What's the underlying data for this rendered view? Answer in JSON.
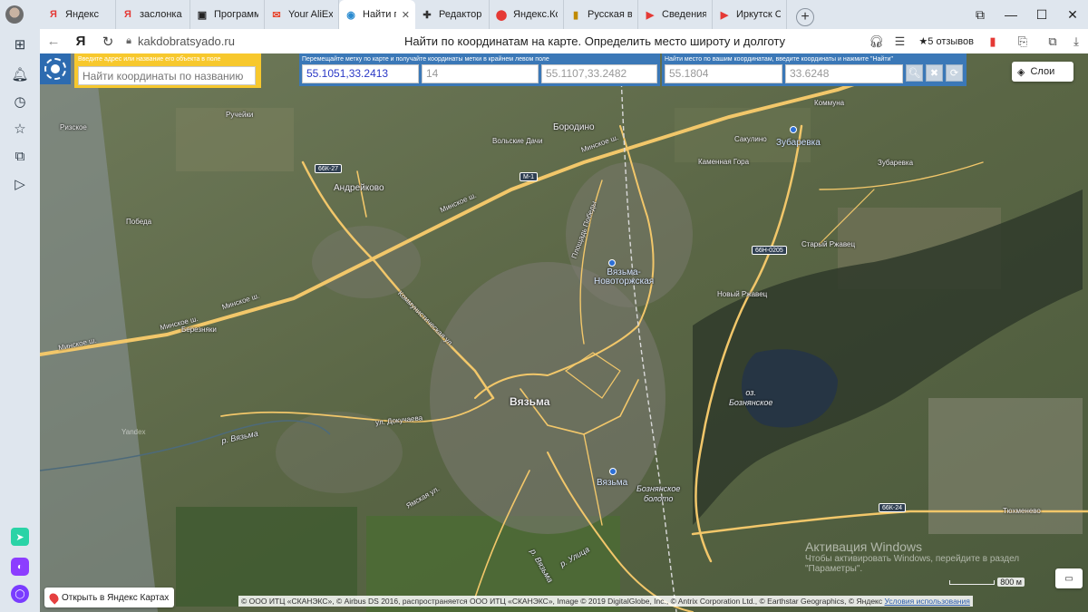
{
  "browser": {
    "tabs": [
      {
        "label": "Яндекс",
        "icon": "yandex-icon",
        "glyph": "Я",
        "color": "#e53935"
      },
      {
        "label": "заслонка огуре",
        "icon": "yandex-icon",
        "glyph": "Я",
        "color": "#e53935"
      },
      {
        "label": "Программа",
        "icon": "media-icon",
        "glyph": "▣",
        "color": "#222"
      },
      {
        "label": "Your AliExpress",
        "icon": "aliexpress-icon",
        "glyph": "✉",
        "color": "#e8452c"
      },
      {
        "label": "Найти по",
        "icon": "globe-icon",
        "glyph": "◉",
        "color": "#2a8bd0",
        "active": true
      },
      {
        "label": "Редактор | Е",
        "icon": "editor-icon",
        "glyph": "✚",
        "color": "#333"
      },
      {
        "label": "Яндекс.Колл",
        "icon": "collections-icon",
        "glyph": "⬤",
        "color": "#e53935"
      },
      {
        "label": "Русская вес",
        "icon": "news-icon",
        "glyph": "▮",
        "color": "#c08a00"
      },
      {
        "label": "Сведения о",
        "icon": "youtube-icon",
        "glyph": "▶",
        "color": "#e53935"
      },
      {
        "label": "Иркутск Сме",
        "icon": "youtube-icon",
        "glyph": "▶",
        "color": "#e53935"
      }
    ],
    "new_tab": "+",
    "window_controls": [
      "⧉",
      "—",
      "☐",
      "✕"
    ],
    "address": {
      "domain": "kakdobratsyado.ru",
      "page_title": "Найти по координатам на карте. Определить место широту и долготу",
      "reviews": "★5 отзывов"
    }
  },
  "panel": {
    "search_label": "Введите адрес или название его объекта в поле",
    "search_placeholder": "Найти координаты по названию",
    "move_label": "Перемещайте метку по карте и получайте координаты метки в крайнем левом поле",
    "marker_coords": "55.1051,33.2413",
    "zoom": "14",
    "corner_coords": "55.1107,33.2482",
    "find_label": "Найти место по вашим координатам, введите координаты и нажмите \"Найти\"",
    "lat": "55.1804",
    "lon": "33.6248",
    "layers": "Слои"
  },
  "map_labels": {
    "vyazma": "Вязьма",
    "andreykovo": "Андрейково",
    "borodino": "Бородино",
    "pobeda": "Победа",
    "berezniaki": "Березняки",
    "ruchyki": "Ручейки",
    "rizskoe": "Ризское",
    "volskie": "Вольские Дачи",
    "sakulino": "Сакулино",
    "zubarevka1": "Зубаревка",
    "zubarevka2": "Зубаревка",
    "kamennaya": "Каменная Гора",
    "kommuna": "Коммуна",
    "stary": "Старый Ржавец",
    "novy": "Новый Ржавец",
    "vyazma_novotor": "Вязьма-\nНовоторжская",
    "vyazma_station": "Вязьма",
    "lake": "оз.\nБознянское",
    "bog": "Бознянское\nболото",
    "tyuhmenevo": "Тюхменево",
    "river": "р. Вязьма",
    "river2": "р. Вязьма",
    "ulitsa": "р. Улица",
    "yandex": "Yandex",
    "minsk1": "Минское ш.",
    "minsk2": "Минское ш.",
    "minsk3": "Минское ш.",
    "minsk4": "Минское ш.",
    "minsk5": "Минское ш.",
    "kommunist": "Коммунистическая ул.",
    "dokuchaeva": "ул. Докучаева",
    "yamskaya": "Ямская ул.",
    "ploschad": "Площадь Победы",
    "shields": [
      "66К-27",
      "М-1",
      "66Н-0205",
      "66К-24"
    ]
  },
  "map_ui": {
    "open_yandex": "Открыть в Яндекс Картах",
    "copyright": "© ООО ИТЦ «СКАНЭКС», © Airbus DS 2016, распространяется ООО ИТЦ «СКАНЭКС», Image © 2019 DigitalGlobe, Inc., © Antrix Corporation Ltd., © Earthstar Geographics, © Яндекс",
    "terms": "Условия использования",
    "scale": "800 м",
    "ruler": "▭"
  },
  "watermark": {
    "line1": "Активация Windows",
    "line2": "Чтобы активировать Windows, перейдите в раздел",
    "line3": "\"Параметры\"."
  }
}
